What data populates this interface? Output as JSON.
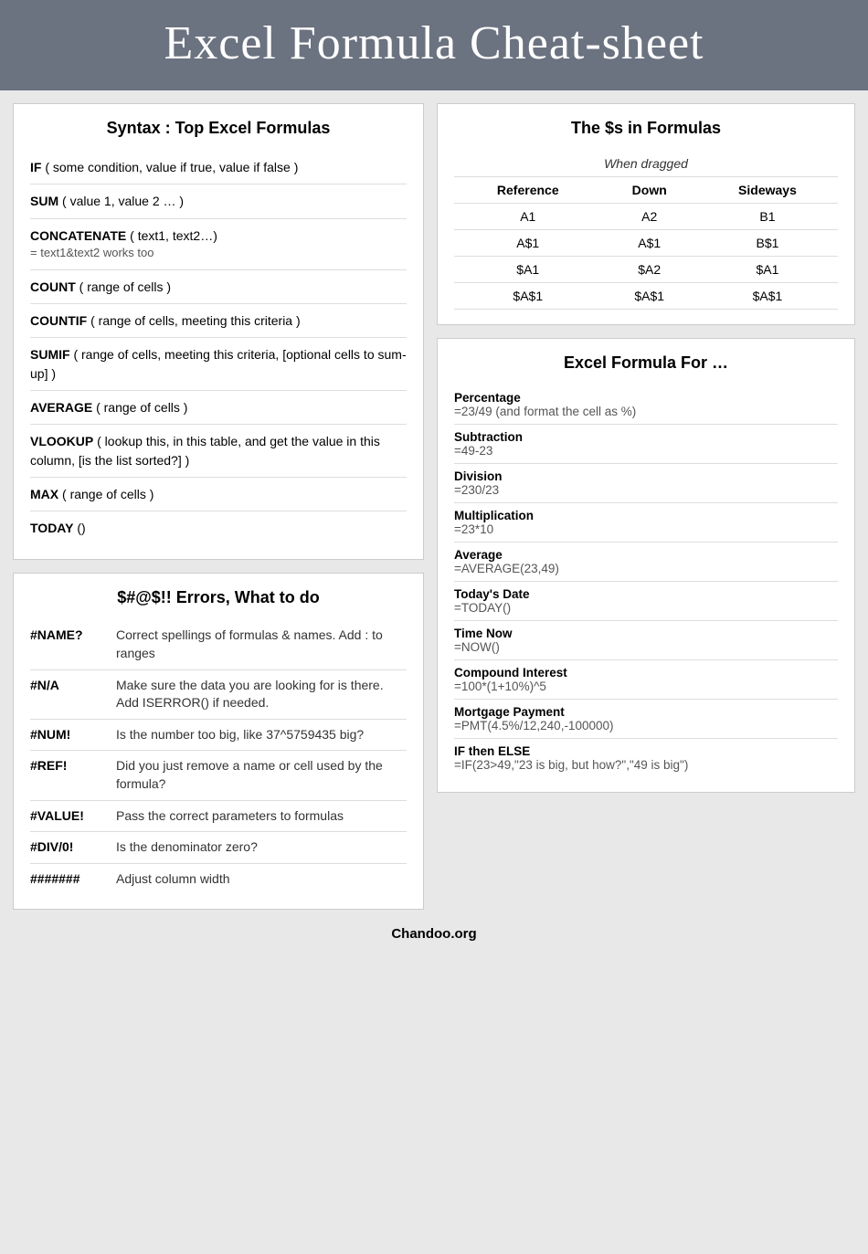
{
  "header": {
    "title": "Excel Formula Cheat-sheet"
  },
  "syntax_section": {
    "title": "Syntax : Top Excel Formulas",
    "formulas": [
      {
        "name": "IF",
        "params": "( some condition, value if true, value if false )",
        "sub": ""
      },
      {
        "name": "SUM",
        "params": "( value 1, value 2 … )",
        "sub": ""
      },
      {
        "name": "CONCATENATE",
        "params": "( text1, text2…)",
        "sub": "= text1&text2 works too"
      },
      {
        "name": "COUNT",
        "params": "( range of cells )",
        "sub": ""
      },
      {
        "name": "COUNTIF",
        "params": "( range of cells, meeting this criteria )",
        "sub": ""
      },
      {
        "name": "SUMIF",
        "params": "( range of cells, meeting this criteria, [optional cells to sum-up] )",
        "sub": ""
      },
      {
        "name": "AVERAGE",
        "params": "( range of cells )",
        "sub": ""
      },
      {
        "name": "VLOOKUP",
        "params": "( lookup this, in this table, and get the value in this column, [is the list sorted?] )",
        "sub": ""
      },
      {
        "name": "MAX",
        "params": "( range of cells )",
        "sub": ""
      },
      {
        "name": "TODAY",
        "params": "()",
        "sub": ""
      }
    ]
  },
  "dollars_section": {
    "title": "The $s in Formulas",
    "when_dragged": "When dragged",
    "headers": [
      "Reference",
      "Down",
      "Sideways"
    ],
    "rows": [
      [
        "A1",
        "A2",
        "B1"
      ],
      [
        "A$1",
        "A$1",
        "B$1"
      ],
      [
        "$A1",
        "$A2",
        "$A1"
      ],
      [
        "$A$1",
        "$A$1",
        "$A$1"
      ]
    ]
  },
  "formula_for_section": {
    "title": "Excel Formula For …",
    "items": [
      {
        "label": "Percentage",
        "value": "=23/49 (and format the cell as %)"
      },
      {
        "label": "Subtraction",
        "value": "=49-23"
      },
      {
        "label": "Division",
        "value": "=230/23"
      },
      {
        "label": "Multiplication",
        "value": "=23*10"
      },
      {
        "label": "Average",
        "value": "=AVERAGE(23,49)"
      },
      {
        "label": "Today's Date",
        "value": "=TODAY()"
      },
      {
        "label": "Time Now",
        "value": "=NOW()"
      },
      {
        "label": "Compound Interest",
        "value": "=100*(1+10%)^5"
      },
      {
        "label": "Mortgage Payment",
        "value": "=PMT(4.5%/12,240,-100000)"
      },
      {
        "label": "IF then ELSE",
        "value": "=IF(23>49,\"23 is big, but how?\",\"49 is big\")"
      }
    ]
  },
  "errors_section": {
    "title": "$#@$!! Errors, What to do",
    "errors": [
      {
        "code": "#NAME?",
        "desc": "Correct spellings of formulas & names. Add : to ranges"
      },
      {
        "code": "#N/A",
        "desc": "Make sure the data you are looking for is there. Add ISERROR() if needed."
      },
      {
        "code": "#NUM!",
        "desc": "Is the number too big, like 37^5759435 big?"
      },
      {
        "code": "#REF!",
        "desc": "Did you just remove a name or cell used by the formula?"
      },
      {
        "code": "#VALUE!",
        "desc": "Pass the correct parameters to formulas"
      },
      {
        "code": "#DIV/0!",
        "desc": "Is the denominator zero?"
      },
      {
        "code": "#######",
        "desc": "Adjust column width"
      }
    ]
  },
  "footer": {
    "text": "Chandoo.org"
  }
}
